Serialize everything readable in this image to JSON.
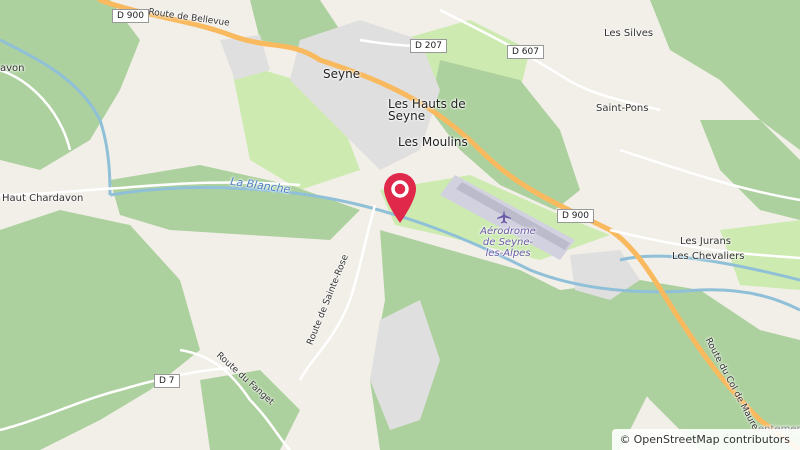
{
  "map": {
    "colors": {
      "land": "#f2efe9",
      "forest": "#add19e",
      "meadow": "#cdebb0",
      "residential": "#e0dfdf",
      "water": "#aad3df",
      "river_line": "#8fc0d8",
      "major_road": "#f9b95e",
      "aerodrome": "#d1d1e0",
      "runway": "#bbbbcc",
      "marker": "#e0284a"
    },
    "labels": {
      "town_seyne": "Seyne",
      "les_hauts_de_seyne": "Les Hauts de Seyne",
      "les_moulins": "Les Moulins",
      "les_silves": "Les Silves",
      "saint_pons": "Saint-Pons",
      "les_jurans": "Les Jurans",
      "les_chevaliers": "Les Chevaliers",
      "haut_chardavon": "Haut Chardavon",
      "chardavon_partial": "avon",
      "river_la_blanche": "La Blanche",
      "aerodrome": "Aérodrome de Seyne-les-Alpes",
      "route_de_bellevue": "Route de Bellevue",
      "route_de_sainte_rose": "Route de Sainte-Rose",
      "route_du_fanget": "Route du Fanget",
      "route_du_col_de_maure": "Route du Col de Maure",
      "partial_east": "entemerle"
    },
    "road_shields": {
      "d900_nw": "D 900",
      "d207": "D 207",
      "d607": "D 607",
      "d900_e": "D 900",
      "d7": "D 7"
    },
    "attribution": {
      "copyright_symbol": "©",
      "text": "OpenStreetMap contributors"
    },
    "marker_icon": "map-pin-icon"
  }
}
